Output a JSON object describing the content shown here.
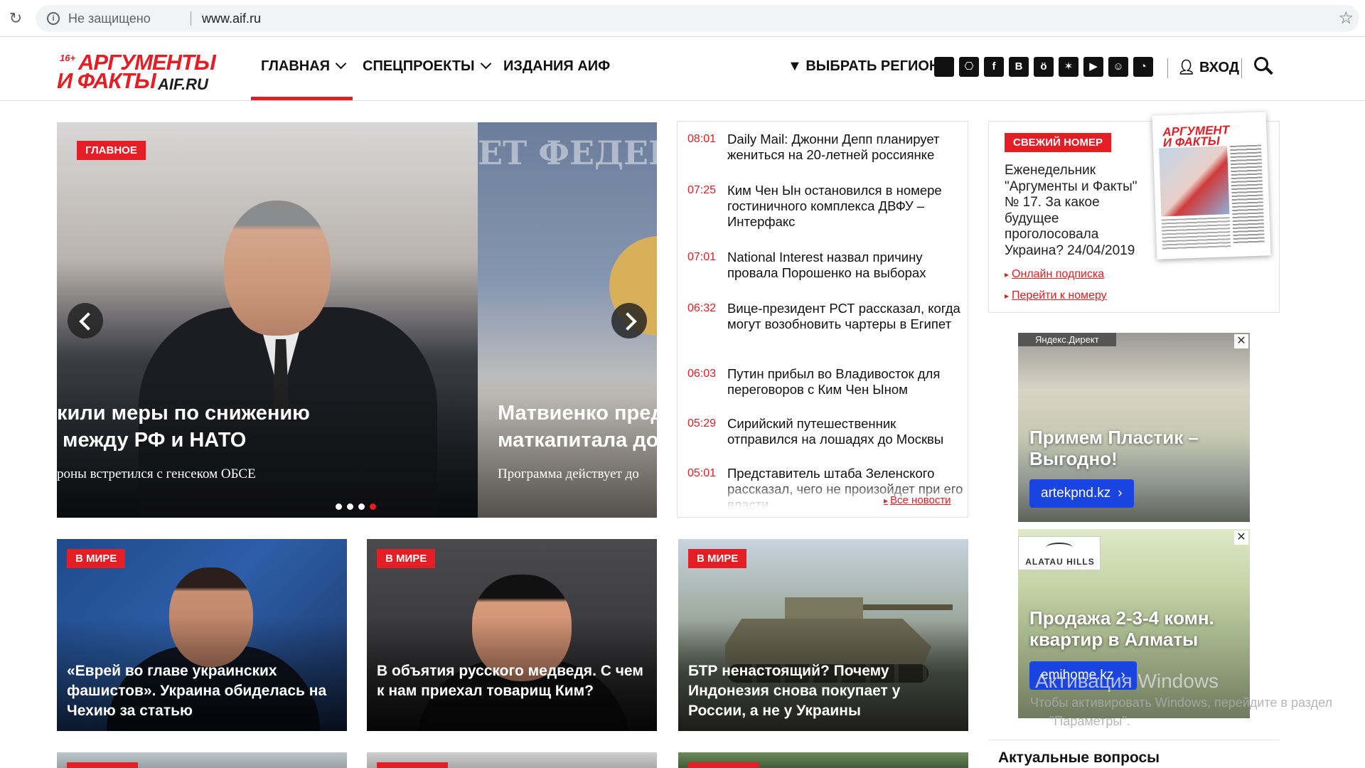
{
  "browser": {
    "insecure_label": "Не защищено",
    "url": "www.aif.ru"
  },
  "header": {
    "logo": {
      "age": "16+",
      "line1": "АРГУМЕНТЫ",
      "line2": "И ФАКТЫ",
      "domain": "AIF.RU"
    },
    "nav": [
      {
        "label": "ГЛАВНАЯ",
        "has_dropdown": true,
        "active": true
      },
      {
        "label": "СПЕЦПРОЕКТЫ",
        "has_dropdown": true,
        "active": false
      },
      {
        "label": "ИЗДАНИЯ АИФ",
        "has_dropdown": false,
        "active": false
      }
    ],
    "region_label": "ВЫБРАТЬ РЕГИОН",
    "social_icons": [
      {
        "name": "apple-icon",
        "glyph": ""
      },
      {
        "name": "android-icon",
        "glyph": "⎔"
      },
      {
        "name": "facebook-icon",
        "glyph": "f"
      },
      {
        "name": "vk-icon",
        "glyph": "B"
      },
      {
        "name": "odnoklassniki-icon",
        "glyph": "ö"
      },
      {
        "name": "twitter-icon",
        "glyph": "✶"
      },
      {
        "name": "youtube-icon",
        "glyph": "▶"
      },
      {
        "name": "zen-icon",
        "glyph": "☺"
      },
      {
        "name": "rss-icon",
        "glyph": "◔"
      }
    ],
    "login_label": "ВХОД",
    "accent_color": "#e31e24"
  },
  "slider": {
    "badge": "ГЛАВНОЕ",
    "slide1": {
      "title_line1": "кили меры по снижению",
      "title_line2": "между РФ и НАТО",
      "subtitle": "роны встретился с генсеком ОБСЕ"
    },
    "slide2": {
      "backdrop_text": "ЕТ ФЕДЕРАЦ",
      "title_line1": "Матвиенко пред",
      "title_line2": "маткапитала до",
      "subtitle": "Программа действует до"
    },
    "dots": 4,
    "active_dot": 4
  },
  "news": {
    "items": [
      {
        "time": "08:01",
        "text": "Daily Mail: Джонни Депп планирует жениться на 20-летней россиянке"
      },
      {
        "time": "07:25",
        "text": "Ким Чен Ын остановился в номере гостиничного комплекса ДВФУ – Интерфакс"
      },
      {
        "time": "07:01",
        "text": "National Interest назвал причину провала Порошенко на выборах"
      },
      {
        "time": "06:32",
        "text": "Вице-президент РСТ рассказал, когда могут возобновить чартеры в Египет"
      },
      {
        "time": "06:03",
        "text": "Путин прибыл во Владивосток для переговоров с Ким Чен Ыном"
      },
      {
        "time": "05:29",
        "text": "Сирийский путешественник отправился на лошадях до Москвы"
      },
      {
        "time": "05:01",
        "text": "Представитель штаба Зеленского рассказал, чего не произойдет при его власти"
      }
    ],
    "all_news_label": "Все новости"
  },
  "fresh_issue": {
    "badge": "СВЕЖИЙ НОМЕР",
    "description": "Еженедельник \"Аргументы и Факты\" № 17. За какое будущее проголосовала Украина? 24/04/2019",
    "subscribe_link": "Онлайн подписка",
    "goto_link": "Перейти к номеру",
    "paper_title_line1": "АРГУМЕНТ",
    "paper_title_line2": "И ФАКТЫ"
  },
  "ads": [
    {
      "label": "Яндекс.Директ",
      "title_line1": "Примем Пластик –",
      "title_line2": "Выгодно!",
      "button": "artekpnd.kz"
    },
    {
      "brand": "ALATAU HILLS",
      "title_line1": "Продажа 2-3-4 комн.",
      "title_line2": "квартир в Алматы",
      "button": "emihome.kz"
    }
  ],
  "cards": [
    {
      "badge": "В МИРЕ",
      "title": "«Еврей во главе украинских фашистов». Украина обиделась на Чехию за статью"
    },
    {
      "badge": "В МИРЕ",
      "title": "В объятия русского медведя. С чем к нам приехал товарищ Ким?"
    },
    {
      "badge": "В МИРЕ",
      "title": "БТР ненастоящий? Почему Индонезия снова покупает у России, а не у Украины"
    }
  ],
  "topics_title": "Актуальные вопросы",
  "windows_watermark": {
    "line1": "Активация Windows",
    "line2": "Чтобы активировать Windows, перейдите в раздел",
    "line3": "\"Параметры\"."
  }
}
